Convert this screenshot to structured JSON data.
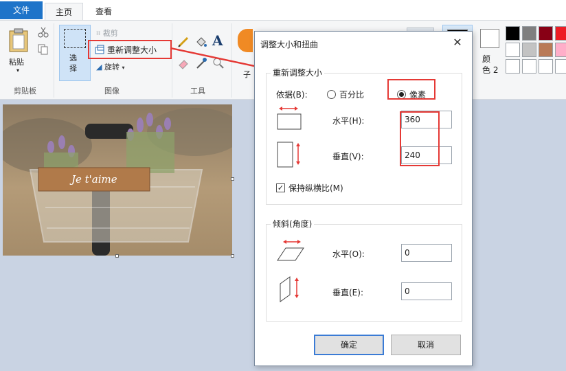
{
  "tabs": {
    "file": "文件",
    "home": "主页",
    "view": "查看"
  },
  "ribbon": {
    "clipboard": {
      "paste": "粘贴",
      "group": "剪贴板"
    },
    "image": {
      "select": "选\n择",
      "crop": "裁剪",
      "resize": "重新调整大小",
      "rotate": "旋转",
      "group": "图像"
    },
    "tools": {
      "group": "工具"
    },
    "color2": {
      "label": "颜\n色 2"
    },
    "palette": [
      "#000000",
      "#7f7f7f",
      "#880015",
      "#ed1c24",
      "#ffffff",
      "#c3c3c3",
      "#b97a57",
      "#ffaec9"
    ]
  },
  "photo": {
    "caption": "Je t'aime"
  },
  "dialog": {
    "title": "调整大小和扭曲",
    "close": "✕",
    "resize": {
      "legend": "重新调整大小",
      "by_label": "依据(B):",
      "percent_option": "百分比",
      "pixels_option": "像素",
      "horizontal_label": "水平(H):",
      "horizontal_value": "360",
      "vertical_label": "垂直(V):",
      "vertical_value": "240",
      "keep_ratio": "保持纵横比(M)"
    },
    "skew": {
      "legend": "倾斜(角度)",
      "horizontal_label": "水平(O):",
      "horizontal_value": "0",
      "vertical_label": "垂直(E):",
      "vertical_value": "0"
    },
    "ok": "确定",
    "cancel": "取消"
  }
}
